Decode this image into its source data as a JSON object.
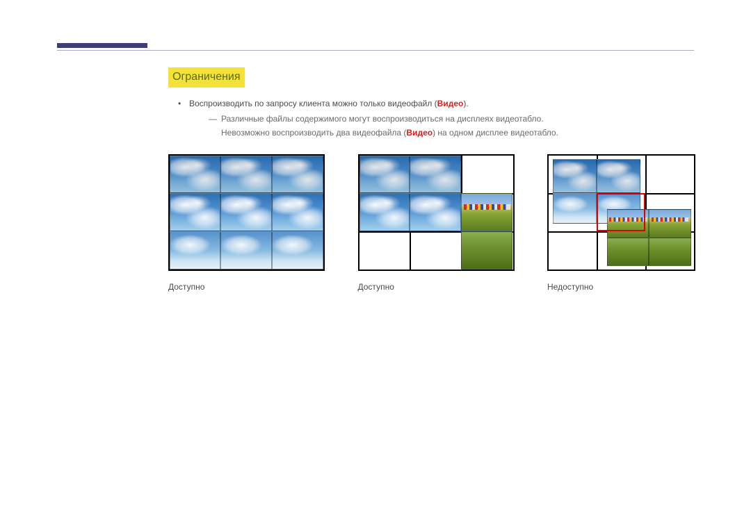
{
  "section": {
    "heading": "Ограничения",
    "bullet1_pre": "Воспроизводить по запросу клиента можно только видеофайл (",
    "bullet1_kw": "Видео",
    "bullet1_post": ").",
    "dash1": "Различные файлы содержимого могут воспроизводиться на дисплеях видеотабло.",
    "dash2_pre": "Невозможно воспроизводить два видеофайла (",
    "dash2_kw": "Видео",
    "dash2_post": ") на одном дисплее видеотабло."
  },
  "figures": {
    "available1": "Доступно",
    "available2": "Доступно",
    "unavailable": "Недоступно"
  }
}
